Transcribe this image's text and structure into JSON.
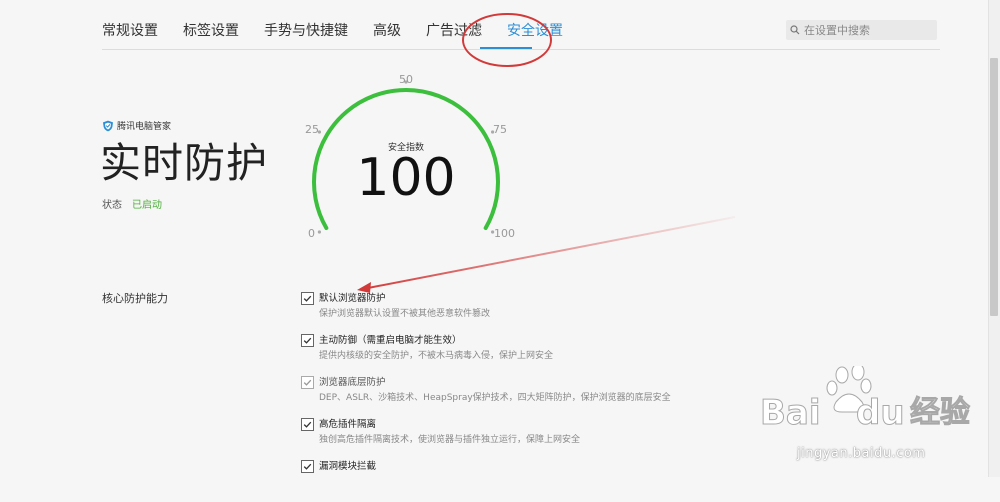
{
  "tabs": [
    {
      "label": "常规设置",
      "active": false
    },
    {
      "label": "标签设置",
      "active": false
    },
    {
      "label": "手势与快捷键",
      "active": false
    },
    {
      "label": "高级",
      "active": false
    },
    {
      "label": "广告过滤",
      "active": false
    },
    {
      "label": "安全设置",
      "active": true
    }
  ],
  "search": {
    "placeholder": "在设置中搜索",
    "value": ""
  },
  "hero": {
    "brand": "腾讯电脑管家",
    "title": "实时防护",
    "status_label": "状态",
    "status_value": "已启动"
  },
  "gauge": {
    "caption": "安全指数",
    "score": "100",
    "score_fraction": 1.0,
    "ticks": [
      "0",
      "25",
      "50",
      "75",
      "100"
    ]
  },
  "section": {
    "label": "核心防护能力",
    "options": [
      {
        "title": "默认浏览器防护",
        "desc": "保护浏览器默认设置不被其他恶意软件篡改",
        "checked": true,
        "disabled": false
      },
      {
        "title": "主动防御（需重启电脑才能生效）",
        "desc": "提供内核级的安全防护，不被木马病毒入侵，保护上网安全",
        "checked": true,
        "disabled": false
      },
      {
        "title": "浏览器底层防护",
        "desc": "DEP、ASLR、沙箱技术、HeapSpray保护技术，四大矩阵防护，保护浏览器的底层安全",
        "checked": true,
        "disabled": true
      },
      {
        "title": "高危插件隔离",
        "desc": "独创高危插件隔离技术，使浏览器与插件独立运行，保障上网安全",
        "checked": true,
        "disabled": false
      },
      {
        "title": "漏洞模块拦截",
        "desc": "",
        "checked": true,
        "disabled": false
      }
    ]
  },
  "watermark": {
    "brand": "Bai du 经验",
    "url": "jingyan.baidu.com"
  },
  "colors": {
    "accent": "#2c8fd6",
    "gauge": "#3cbf3c",
    "status": "#4caf3a",
    "annotation": "#d23a3a"
  }
}
